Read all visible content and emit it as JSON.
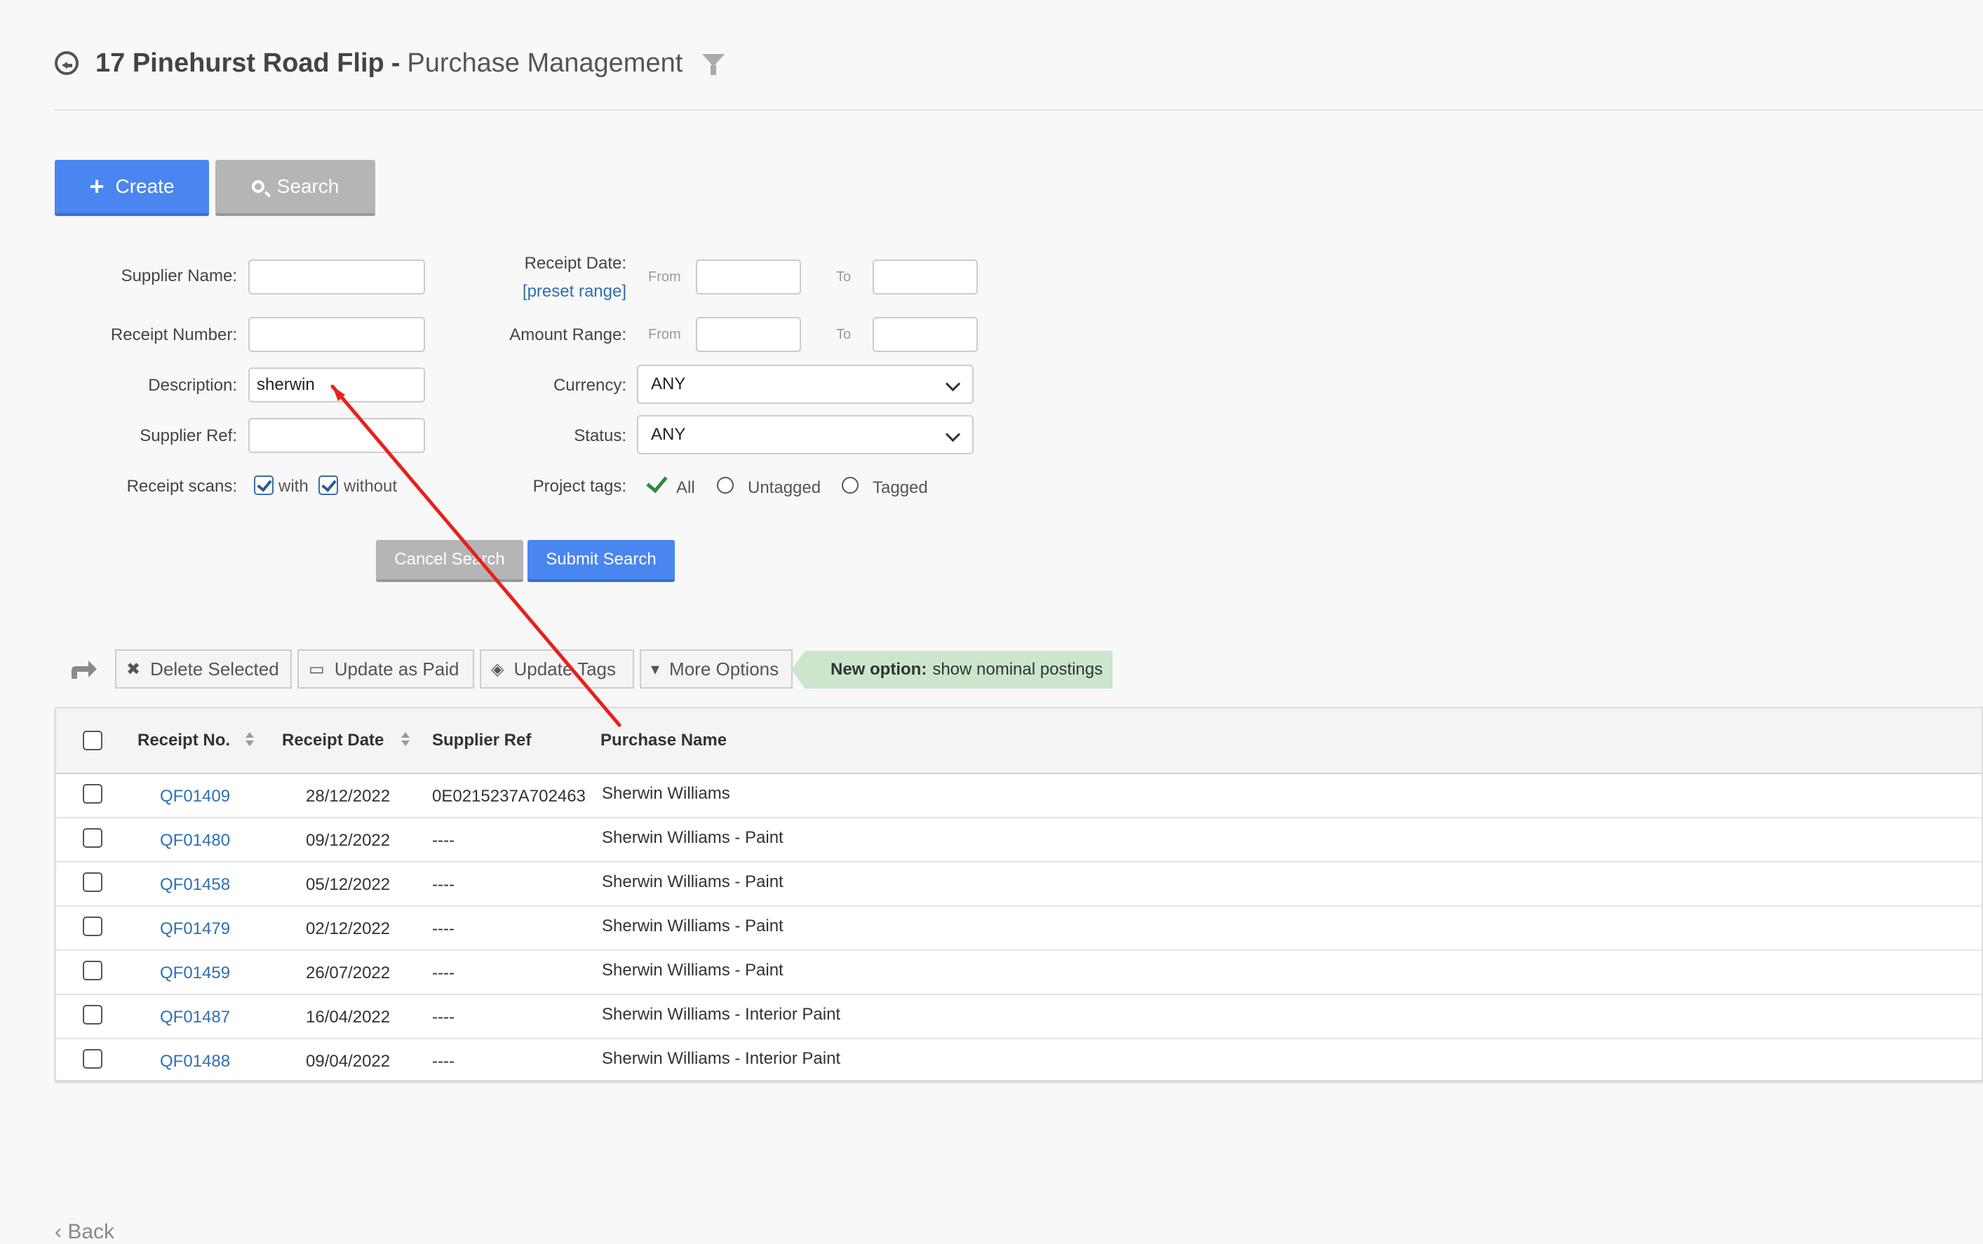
{
  "header": {
    "project": "17 Pinehurst Road Flip",
    "separator": "-",
    "section": "Purchase Management"
  },
  "actions": {
    "create": "Create",
    "search": "Search"
  },
  "form": {
    "supplier_name": {
      "label": "Supplier Name:",
      "value": ""
    },
    "receipt_number": {
      "label": "Receipt Number:",
      "value": ""
    },
    "description": {
      "label": "Description:",
      "value": "sherwin"
    },
    "supplier_ref": {
      "label": "Supplier Ref:",
      "value": ""
    },
    "receipt_scans": {
      "label": "Receipt scans:",
      "with": "with",
      "without": "without",
      "with_checked": true,
      "without_checked": true
    },
    "receipt_date": {
      "label": "Receipt Date:",
      "preset": "[preset range]",
      "from": "From",
      "to": "To"
    },
    "amount_range": {
      "label": "Amount Range:",
      "from": "From",
      "to": "To"
    },
    "currency": {
      "label": "Currency:",
      "value": "ANY"
    },
    "status": {
      "label": "Status:",
      "value": "ANY"
    },
    "project_tags": {
      "label": "Project tags:",
      "all": "All",
      "untagged": "Untagged",
      "tagged": "Tagged",
      "selected": "All"
    },
    "cancel": "Cancel Search",
    "submit": "Submit Search"
  },
  "toolbar": {
    "delete": "Delete Selected",
    "paid": "Update as Paid",
    "tags": "Update Tags",
    "more": "More Options",
    "new_option_bold": "New option:",
    "new_option_text": "show nominal postings"
  },
  "table": {
    "columns": [
      "Receipt No.",
      "Receipt Date",
      "Supplier Ref",
      "Purchase Name"
    ],
    "rows": [
      {
        "no": "QF01409",
        "date": "28/12/2022",
        "ref": "0E0215237A702463",
        "name": "Sherwin Williams"
      },
      {
        "no": "QF01480",
        "date": "09/12/2022",
        "ref": "----",
        "name": "Sherwin Williams - Paint"
      },
      {
        "no": "QF01458",
        "date": "05/12/2022",
        "ref": "----",
        "name": "Sherwin Williams - Paint"
      },
      {
        "no": "QF01479",
        "date": "02/12/2022",
        "ref": "----",
        "name": "Sherwin Williams - Paint"
      },
      {
        "no": "QF01459",
        "date": "26/07/2022",
        "ref": "----",
        "name": "Sherwin Williams - Paint"
      },
      {
        "no": "QF01487",
        "date": "16/04/2022",
        "ref": "----",
        "name": "Sherwin Williams - Interior Paint"
      },
      {
        "no": "QF01488",
        "date": "09/04/2022",
        "ref": "----",
        "name": "Sherwin Williams - Interior Paint"
      }
    ]
  },
  "footer": {
    "back": "Back"
  },
  "colors": {
    "primary": "#4a86ef",
    "link": "#2f6fb3",
    "annotation": "#e8201a"
  }
}
